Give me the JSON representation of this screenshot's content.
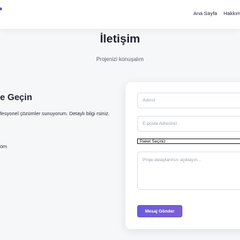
{
  "nav": {
    "links": [
      {
        "label": "Ana Sayfa"
      },
      {
        "label": "Hakkım"
      }
    ]
  },
  "section": {
    "title": "İletişim",
    "subtitle": "Projenizi konuşalım"
  },
  "info": {
    "heading": "e Geçin",
    "text": "fesyonel çözümler sunuyorum. Detaylı bilgi rsiniz.",
    "email": "om"
  },
  "form": {
    "name_placeholder": "Adınız",
    "email_placeholder": "E-posta Adresiniz",
    "package_selected": "Paket Seçiniz",
    "message_placeholder": "Proje detaylarınızı açıklayın...",
    "submit_label": "Mesaj Gönder"
  },
  "colors": {
    "accent": "#6a5ce0",
    "background": "#f6f7f9"
  }
}
